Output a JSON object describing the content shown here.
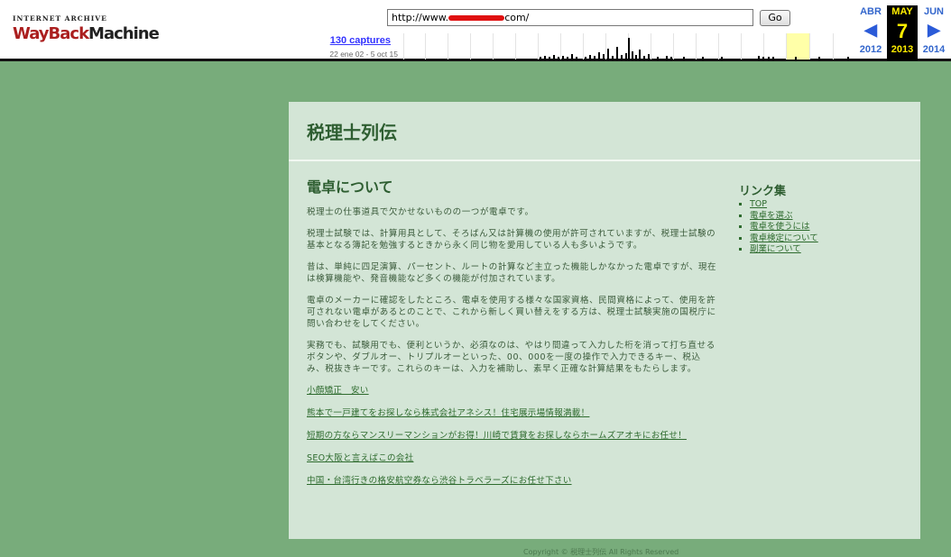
{
  "toolbar": {
    "logo_line1": "INTERNET ARCHIVE",
    "logo_wayback": "WayBack",
    "logo_machine": "Machine",
    "url_prefix": "http://www.",
    "url_suffix": "com/",
    "go_label": "Go",
    "captures_label": "130 captures",
    "date_range": "22 ene 02 - 5 oct 15",
    "prev": {
      "month": "ABR",
      "year": "2012"
    },
    "current": {
      "month": "MAY",
      "day": "7",
      "year": "2013"
    },
    "next": {
      "month": "JUN",
      "year": "2014"
    },
    "arrow_left": "◀",
    "arrow_right": "▶"
  },
  "site": {
    "title": "税理士列伝",
    "heading": "電卓について",
    "paragraphs": [
      "税理士の仕事道具で欠かせないものの一つが電卓です。",
      "税理士試験では、計算用具として、そろばん又は計算機の使用が許可されていますが、税理士試験の基本となる簿記を勉強するときから永く同じ物を愛用している人も多いようです。",
      "昔は、単純に四足演算、パーセント、ルートの計算など主立った機能しかなかった電卓ですが、現在は検算機能や、発音機能など多くの機能が付加されています。",
      "電卓のメーカーに確認をしたところ、電卓を使用する様々な国家資格、民間資格によって、使用を許可されない電卓があるとのことで、これから新しく買い替えをする方は、税理士試験実施の国税庁に問い合わせをしてください。",
      "実務でも、試験用でも、便利というか、必須なのは、やはり間違って入力した桁を消って打ち直せるボタンや、ダブルオー、トリプルオーといった、00、000を一度の操作で入力できるキー、税込み、税抜きキーです。これらのキーは、入力を補助し、素早く正確な計算結果をもたらします。"
    ],
    "ad_links": [
      "小顔矯正　安い",
      "熊本で一戸建てをお探しなら株式会社アネシス！住宅展示場情報満載！",
      "短期の方ならマンスリーマンションがお得！川崎で賃貸をお探しならホームズアオキにお任せ！",
      "SEO大阪と言えばこの会社",
      "中国・台湾行きの格安航空券なら渋谷トラベラーズにお任せ下さい"
    ],
    "sidebar_title": "リンク集",
    "sidebar_links": [
      "TOP",
      "電卓を選ぶ",
      "電卓を使うには",
      "電卓検定について",
      "副業について"
    ],
    "footer": "Copyright © 税理士列伝 All Rights Reserved"
  },
  "colors": {
    "page_bg": "#78ac7b",
    "content_bg": "#d3e5d6",
    "heading": "#2e5e31",
    "link": "#2e6b2e",
    "wayback_blue": "#3366cc",
    "wayback_current": "#ffee00"
  }
}
